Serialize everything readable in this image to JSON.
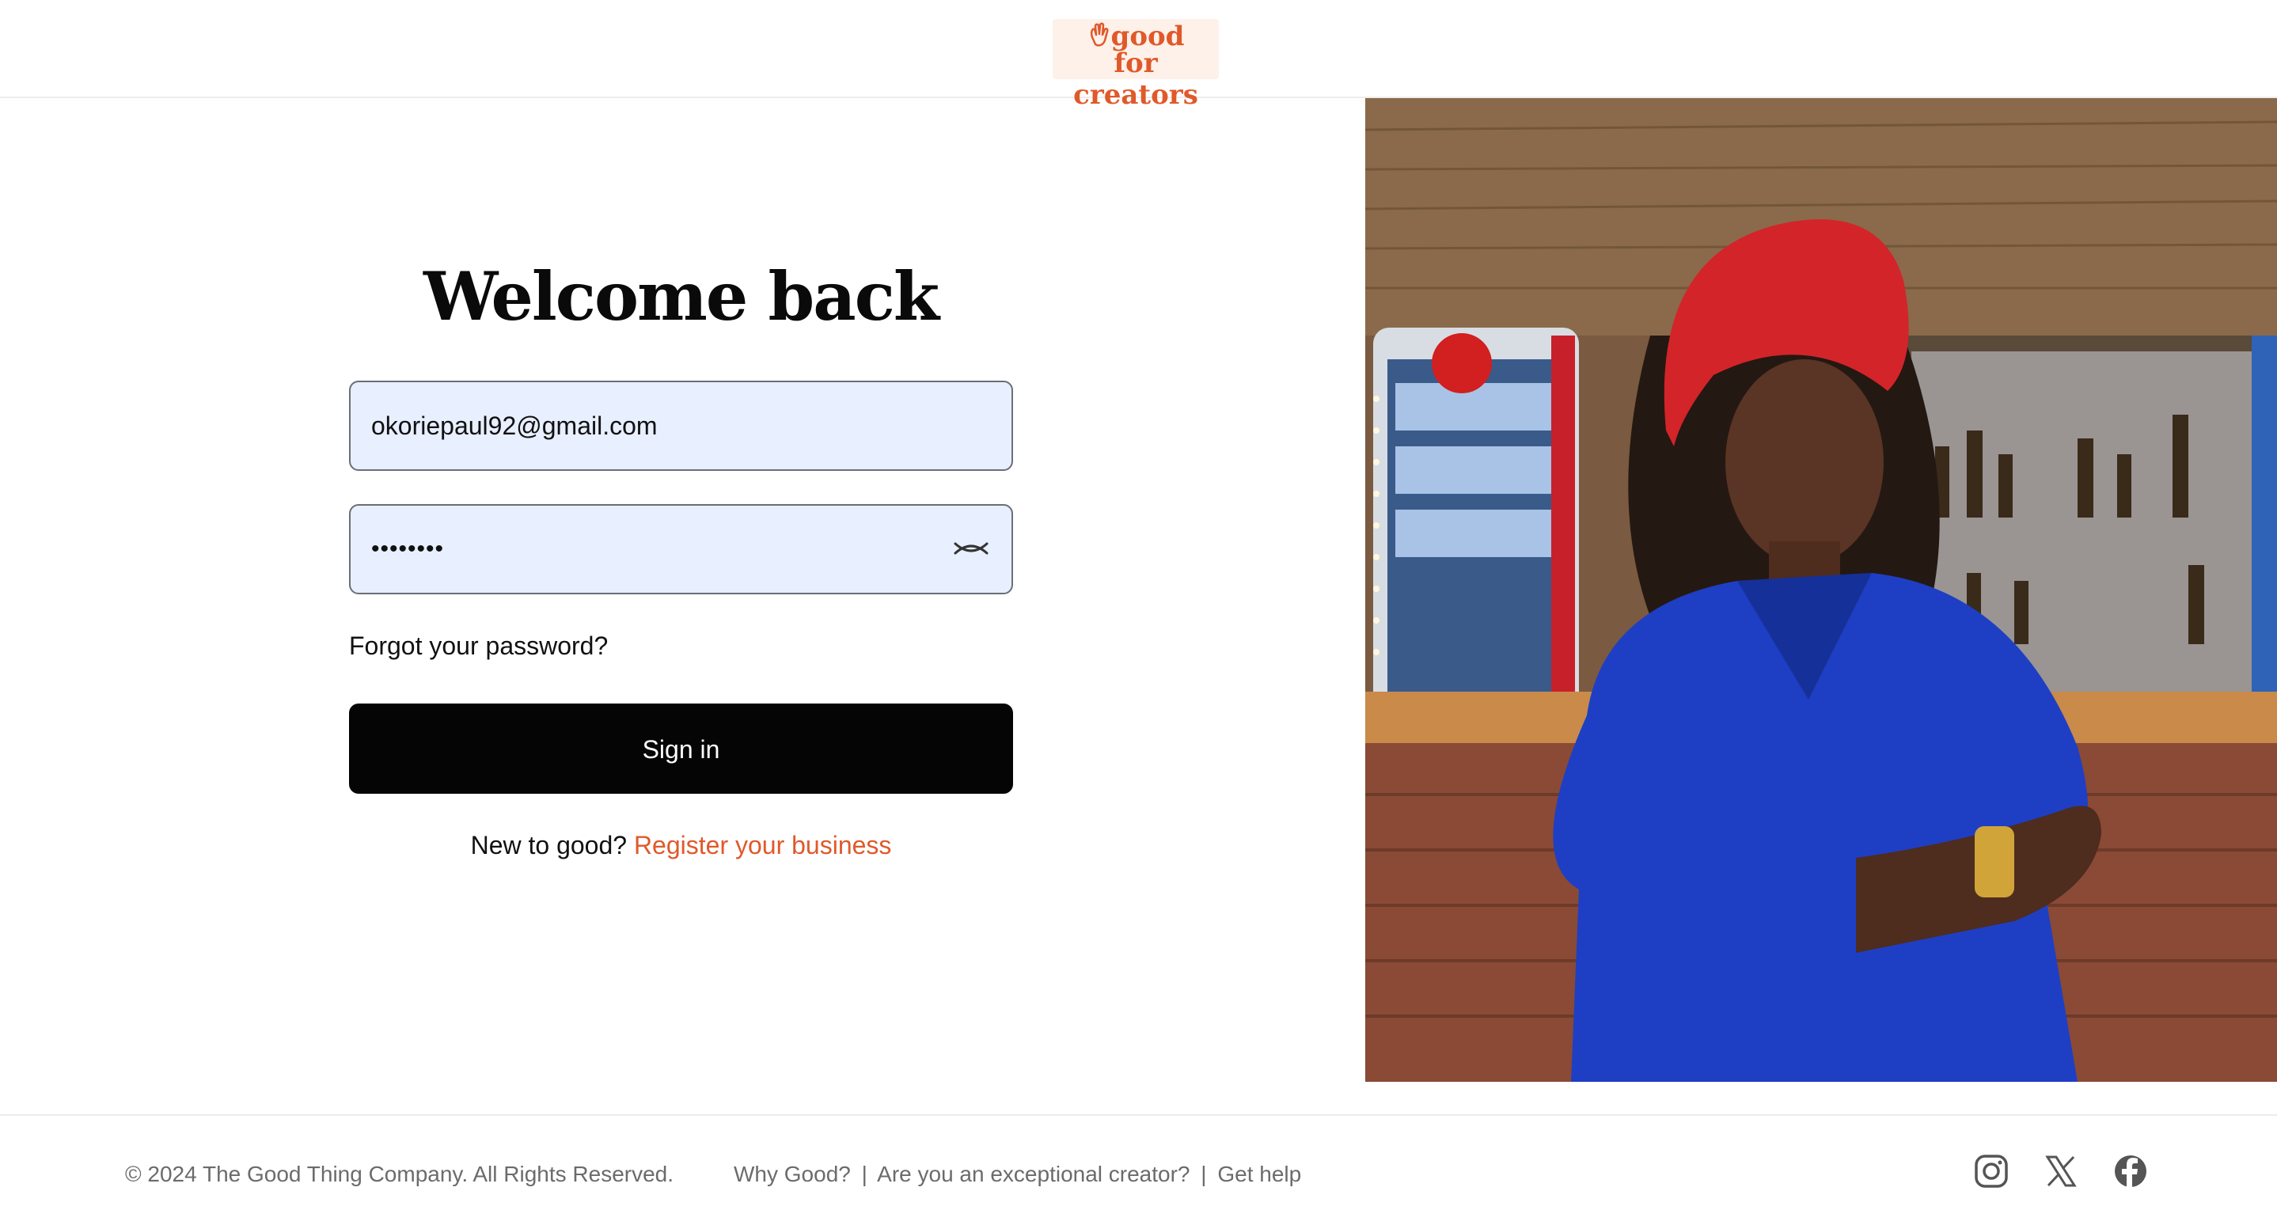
{
  "header": {
    "logo_line1": "good",
    "logo_line2": "for creators"
  },
  "login": {
    "title": "Welcome back",
    "email_value": "okoriepaul92@gmail.com",
    "password_value": "••••••••",
    "forgot_label": "Forgot your password?",
    "signin_label": "Sign in",
    "new_prompt": "New to good?",
    "register_label": "Register your business"
  },
  "footer": {
    "copyright": "© 2024 The Good Thing Company. All Rights Reserved.",
    "links": [
      "Why Good?",
      "Are you an exceptional creator?",
      "Get help"
    ],
    "separator": "|",
    "social_icons": [
      "instagram-icon",
      "x-icon",
      "facebook-icon"
    ]
  },
  "colors": {
    "accent": "#e0592a",
    "input_bg": "#e8effe",
    "button_bg": "#050505",
    "muted_text": "#6b6b6b"
  }
}
